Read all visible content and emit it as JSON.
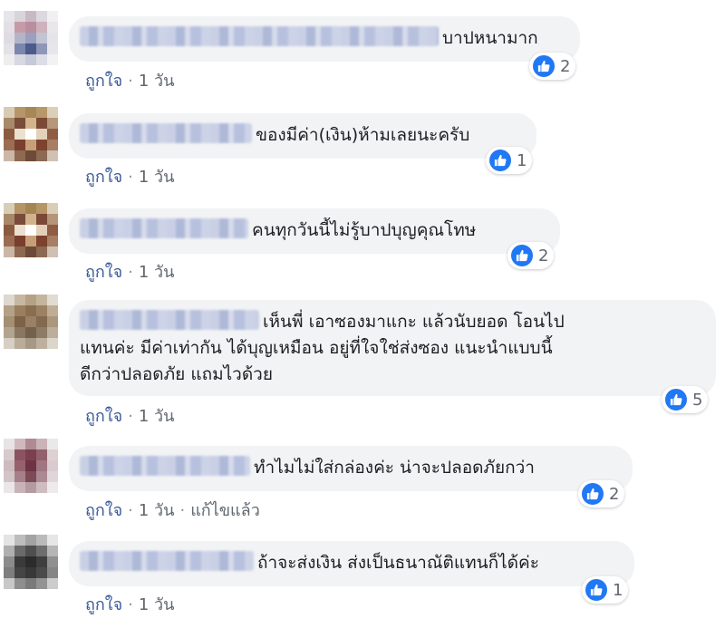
{
  "comments": [
    {
      "text": "บาปหนามาก",
      "likes": "2",
      "meta": {
        "like_label": "ถูกใจ",
        "time": "1 วัน"
      }
    },
    {
      "text": "ของมีค่า(เงิน)ห้ามเลยนะครับ",
      "likes": "1",
      "meta": {
        "like_label": "ถูกใจ",
        "time": "1 วัน"
      }
    },
    {
      "text": "คนทุกวันนี้ไม่รู้บาปบุญคุณโทษ",
      "likes": "2",
      "meta": {
        "like_label": "ถูกใจ",
        "time": "1 วัน"
      }
    },
    {
      "text_line1": "เห็นพี่ เอาซองมาแกะ แล้วนับยอด โอนไป",
      "text_line2": "แทนค่ะ มีค่าเท่ากัน ได้บุญเหมือน อยู่ที่ใจใช่ส่งซอง แนะนำแบบนี้",
      "text_line3": "ดีกว่าปลอดภัย แถมไวด้วย",
      "likes": "5",
      "meta": {
        "like_label": "ถูกใจ",
        "time": "1 วัน"
      }
    },
    {
      "text": "ทำไมไม่ใส่กล่องค่ะ น่าจะปลอดภัยกว่า",
      "likes": "2",
      "meta": {
        "like_label": "ถูกใจ",
        "time": "1 วัน",
        "edited": "แก้ไขแล้ว"
      }
    },
    {
      "text": "ถ้าจะส่งเงิน ส่งเป็นธนาณัติแทนก็ได้ค่ะ",
      "likes": "1",
      "meta": {
        "like_label": "ถูกใจ",
        "time": "1 วัน"
      }
    }
  ],
  "icons": {
    "reaction": "thumbs-up-icon",
    "avatar": "pixelated-avatar"
  },
  "colors": {
    "bubble": "#f2f3f5",
    "like_blue": "#2078f4",
    "link": "#385898"
  }
}
